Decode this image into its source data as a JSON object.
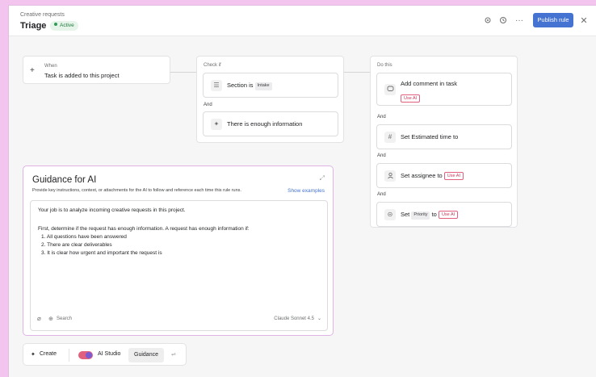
{
  "header": {
    "breadcrumb": "Creative requests",
    "title": "Triage",
    "status_badge": "Active",
    "publish_label": "Publish rule",
    "icons": [
      "gear-icon",
      "history-icon",
      "more-icon",
      "close-icon"
    ]
  },
  "when": {
    "label": "When",
    "trigger": "Task is added to this project"
  },
  "check_if": {
    "label": "Check if",
    "conditions": [
      {
        "text": "Section is",
        "chip": "Intake",
        "icon": "list-icon"
      },
      {
        "text": "There is enough information",
        "icon": "sparkle-icon"
      }
    ],
    "and_label": "And"
  },
  "do_this": {
    "label": "Do this",
    "and_label": "And",
    "actions": [
      {
        "text": "Add comment in task",
        "chip": "Use AI",
        "icon": "comment-icon"
      },
      {
        "text": "Set Estimated time to",
        "icon": "hash-icon"
      },
      {
        "text": "Set assignee to",
        "chip": "Use AI",
        "icon": "person-icon"
      },
      {
        "text": "Set",
        "chip_grey": "Priority",
        "text2": "to",
        "chip": "Use AI",
        "icon": "circle-check-icon"
      }
    ]
  },
  "guidance": {
    "title": "Guidance for AI",
    "description": "Provide key instructions, context, or attachments for the AI to follow and reference each time this rule runs.",
    "show_examples": "Show examples",
    "lines": [
      "Your job is to analyze incoming creative requests in this project.",
      "",
      "First, determine if the request has enough information. A request has enough information if:",
      "1. All questions have been answered",
      "2. There are clear deliverables",
      "3. It is clear how urgent and important the request is"
    ],
    "search_label": "Search",
    "model_label": "Claude Sonnet 4.5"
  },
  "toolbar": {
    "create_label": "Create",
    "ai_studio_label": "AI Studio",
    "guidance_label": "Guidance"
  },
  "colors": {
    "accent": "#4573d2",
    "active_green": "#2e9b58",
    "ai_pink": "#e0607e",
    "background": "#f2c4ee"
  }
}
